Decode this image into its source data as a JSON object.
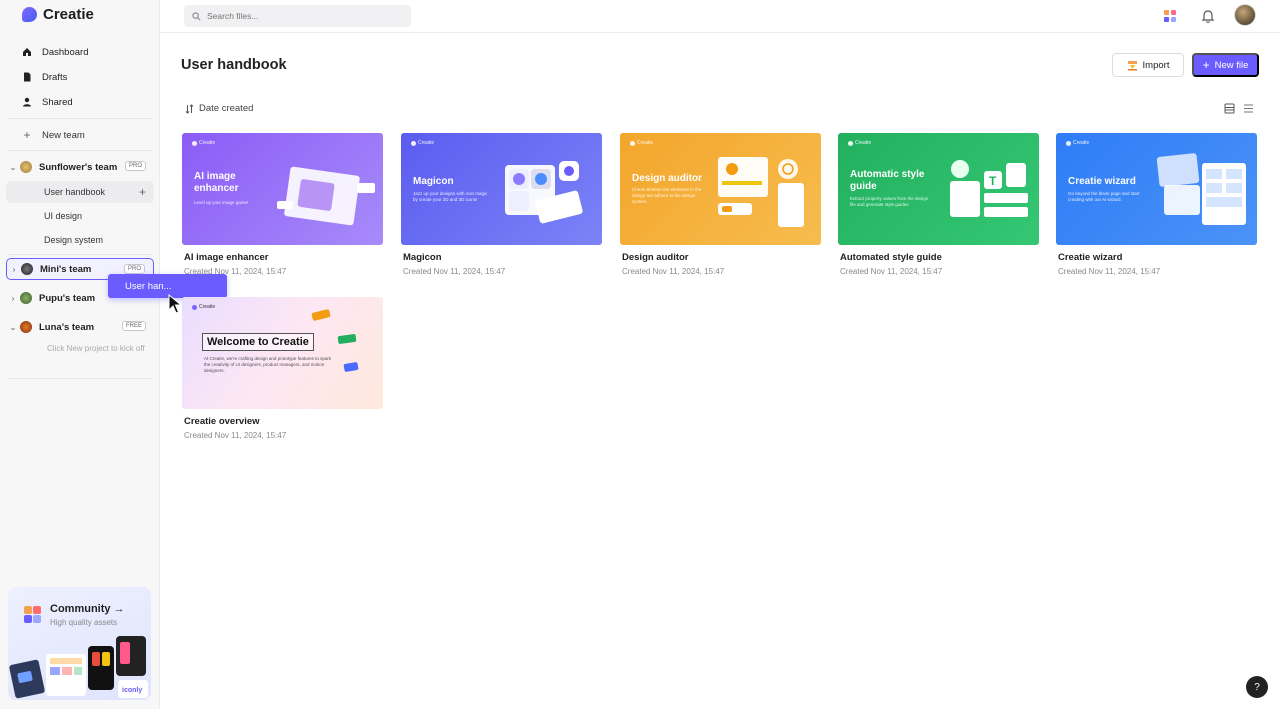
{
  "app": {
    "name": "Creatie"
  },
  "search": {
    "placeholder": "Search files..."
  },
  "nav": [
    {
      "label": "Dashboard",
      "icon": "home-icon"
    },
    {
      "label": "Drafts",
      "icon": "file-icon"
    },
    {
      "label": "Shared",
      "icon": "user-icon"
    }
  ],
  "new_team": "New team",
  "teams": [
    {
      "name": "Sunflower's team",
      "badge": "PRO",
      "expanded": true,
      "projects": [
        "User handbook",
        "UI design",
        "Design system"
      ]
    },
    {
      "name": "Mini's team",
      "badge": "PRO",
      "expanded": false
    },
    {
      "name": "Pupu's team",
      "badge": "",
      "expanded": false
    },
    {
      "name": "Luna's team",
      "badge": "FREE",
      "expanded": true,
      "empty_hint": "Click New project to kick off"
    }
  ],
  "drag_tooltip": "User han...",
  "community": {
    "title": "Community →",
    "subtitle": "High quality assets"
  },
  "page": {
    "title": "User handbook",
    "import_label": "Import",
    "new_file_label": "New file",
    "sort_label": "Date created"
  },
  "files": [
    {
      "name": "AI image enhancer",
      "created": "Created Nov 11, 2024, 15:47",
      "thumb_title": "AI image enhancer",
      "thumb_desc": "Level up your image game!",
      "color_from": "#8b5cf6",
      "color_to": "#a78bfa"
    },
    {
      "name": "Magicon",
      "created": "Created Nov 11, 2024, 15:47",
      "thumb_title": "Magicon",
      "thumb_desc": "Jazz up your designs with icon magic by create your 2D and 3D icons!",
      "color_from": "#5b5cf0",
      "color_to": "#7c83f7"
    },
    {
      "name": "Design auditor",
      "created": "Created Nov 11, 2024, 15:47",
      "thumb_title": "Design auditor",
      "thumb_desc": "Check whether the elements in the design are adhere to the design system.",
      "color_from": "#f3a62b",
      "color_to": "#f7bc4e"
    },
    {
      "name": "Automated style guide",
      "created": "Created Nov 11, 2024, 15:47",
      "thumb_title": "Automatic style guide",
      "thumb_desc": "Extract property values from the design file and generate style guides",
      "color_from": "#22b05e",
      "color_to": "#35c774"
    },
    {
      "name": "Creatie wizard",
      "created": "Created Nov 11, 2024, 15:47",
      "thumb_title": "Creatie wizard",
      "thumb_desc": "Go beyond the blank page and start creating with our AI wizard.",
      "color_from": "#2f7cf6",
      "color_to": "#4a93f8"
    },
    {
      "name": "Creatie overview",
      "created": "Created Nov 11, 2024, 15:47",
      "thumb_title": "Welcome to Creatie",
      "thumb_desc": "At Creatie, we're crafting design and prototype features to spark the creativity of UI designers, product managers, and motion designers.",
      "color_from": "#fde7f3",
      "color_to": "#e6dcff"
    }
  ],
  "help_label": "?"
}
